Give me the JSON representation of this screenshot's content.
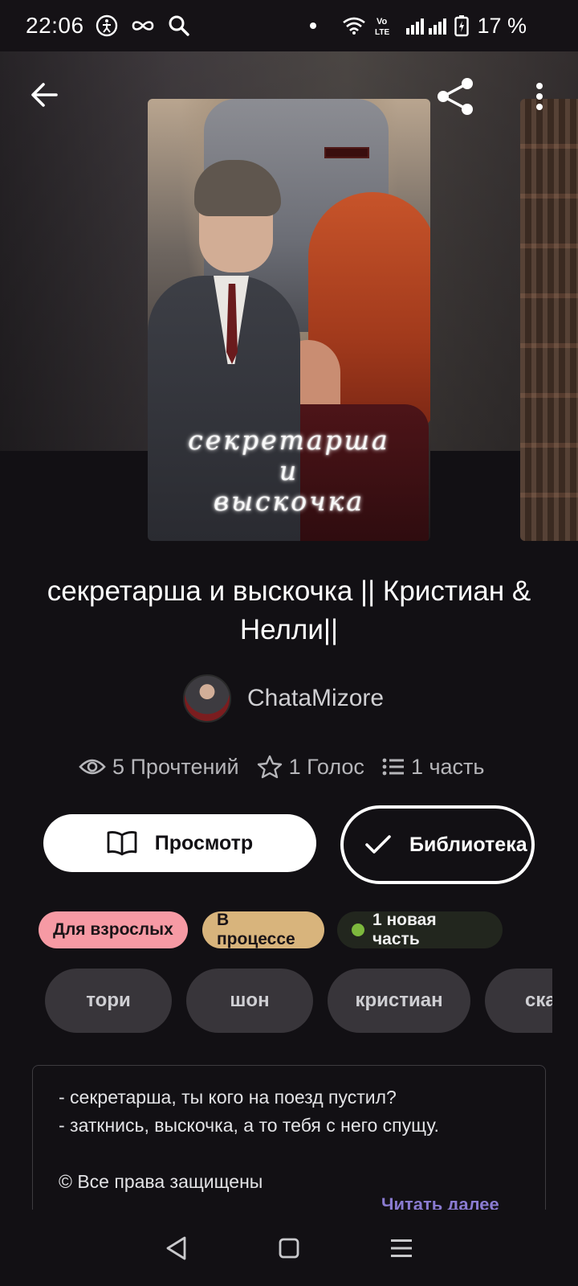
{
  "status_bar": {
    "time": "22:06",
    "battery": "17 %",
    "left_icons": [
      "accessibility-icon",
      "link-icon",
      "search-icon"
    ],
    "right_icons": [
      "wifi-icon",
      "volte-icon",
      "signal-icon",
      "battery-charging-icon"
    ]
  },
  "header": {
    "back_icon": "arrow-left-icon",
    "share_icon": "share-icon",
    "more_icon": "more-vertical-icon"
  },
  "cover": {
    "title_line1": "секретарша",
    "title_line2": "и",
    "title_line3": "выскочка"
  },
  "story": {
    "title": "секретарша и выскочка || Кристиан & Нелли||",
    "author": "ChataMizore"
  },
  "stats": {
    "reads": "5 Прочтений",
    "votes": "1 Голос",
    "parts": "1 часть"
  },
  "actions": {
    "read_label": "Просмотр",
    "library_label": "Библиотека"
  },
  "badges": {
    "mature": "Для взрослых",
    "status": "В процессе",
    "new_parts": "1 новая часть"
  },
  "tags": [
    "тори",
    "шон",
    "кристиан",
    "скандал"
  ],
  "description": {
    "lines": [
      "- секретарша, ты кого на поезд пустил?",
      "- заткнись, выскочка, а то тебя с него спущу.",
      "",
      "© Все права защищены"
    ],
    "more_label": "Читать далее"
  },
  "colors": {
    "background": "#121014",
    "mature_badge": "#f69aa4",
    "progress_badge": "#d8b47c",
    "new_dot": "#7db83d",
    "link": "#8a7bd1"
  },
  "nav": [
    "back-triangle-icon",
    "home-square-icon",
    "menu-lines-icon"
  ]
}
